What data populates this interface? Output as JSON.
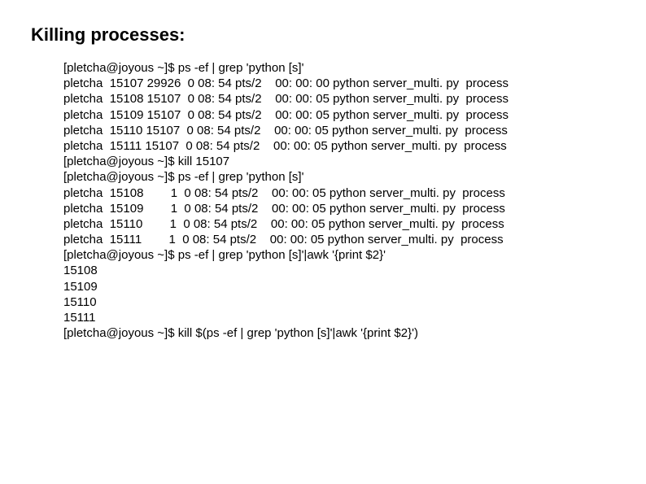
{
  "heading": "Killing processes:",
  "lines": [
    "[pletcha@joyous ~]$ ps -ef | grep 'python [s]'",
    "pletcha  15107 29926  0 08: 54 pts/2    00: 00: 00 python server_multi. py  process",
    "pletcha  15108 15107  0 08: 54 pts/2    00: 00: 05 python server_multi. py  process",
    "pletcha  15109 15107  0 08: 54 pts/2    00: 00: 05 python server_multi. py  process",
    "pletcha  15110 15107  0 08: 54 pts/2    00: 00: 05 python server_multi. py  process",
    "pletcha  15111 15107  0 08: 54 pts/2    00: 00: 05 python server_multi. py  process",
    "[pletcha@joyous ~]$ kill 15107",
    "[pletcha@joyous ~]$ ps -ef | grep 'python [s]'",
    "pletcha  15108        1  0 08: 54 pts/2    00: 00: 05 python server_multi. py  process",
    "pletcha  15109        1  0 08: 54 pts/2    00: 00: 05 python server_multi. py  process",
    "pletcha  15110        1  0 08: 54 pts/2    00: 00: 05 python server_multi. py  process",
    "pletcha  15111        1  0 08: 54 pts/2    00: 00: 05 python server_multi. py  process",
    "[pletcha@joyous ~]$ ps -ef | grep 'python [s]'|awk '{print $2}'",
    "15108",
    "15109",
    "15110",
    "15111",
    "[pletcha@joyous ~]$ kill $(ps -ef | grep 'python [s]'|awk '{print $2}')"
  ]
}
